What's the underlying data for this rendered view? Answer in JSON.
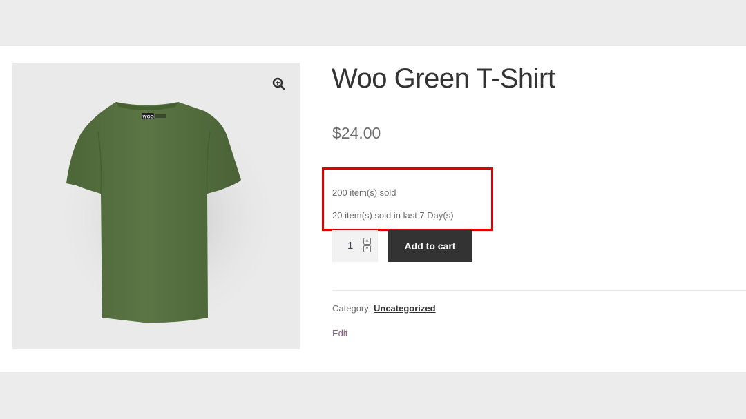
{
  "product": {
    "title": "Woo Green T-Shirt",
    "price": "$24.00",
    "sold_total": "200 item(s) sold",
    "sold_recent": "20 item(s) sold in last 7 Day(s)",
    "quantity": "1",
    "add_to_cart_label": "Add to cart",
    "category_label": "Category:",
    "category_value": "Uncategorized",
    "edit_label": "Edit",
    "shirt_logo_text": "WOO"
  },
  "colors": {
    "shirt": "#566f3f",
    "highlight_box": "#e00000",
    "button": "#333333",
    "edit_link": "#96588a"
  },
  "icons": {
    "zoom": "zoom-in-icon"
  }
}
